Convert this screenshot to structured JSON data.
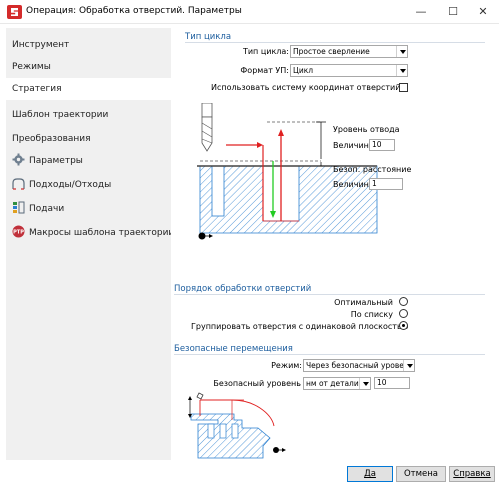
{
  "window": {
    "title": "Операция: Обработка отверстий. Параметры",
    "minimize_glyph": "—",
    "maximize_glyph": "☐",
    "close_glyph": "✕"
  },
  "sidebar": {
    "items": [
      {
        "label": "Инструмент",
        "icon": ""
      },
      {
        "label": "Режимы",
        "icon": ""
      },
      {
        "label": "Стратегия",
        "icon": "",
        "active": true
      },
      {
        "label": "Шаблон траектории",
        "icon": ""
      },
      {
        "label": "Преобразования",
        "icon": ""
      },
      {
        "label": "Параметры",
        "icon": "gear-icon"
      },
      {
        "label": "Подходы/Отходы",
        "icon": "approach-icon"
      },
      {
        "label": "Подачи",
        "icon": "feeds-icon"
      },
      {
        "label": "Макросы шаблона траектории",
        "icon": "macro-icon"
      }
    ]
  },
  "cycle": {
    "section_title": "Тип цикла",
    "type_label": "Тип цикла:",
    "type_value": "Простое сверление",
    "format_label": "Формат УП:",
    "format_value": "Цикл",
    "use_hole_cs_label": "Использовать систему координат отверстий",
    "use_hole_cs_checked": false
  },
  "diagram": {
    "retract_level_label": "Уровень отвода",
    "retract_value_label": "Величина:",
    "retract_value": "10",
    "safe_distance_label": "Безоп. расстояние",
    "safe_value_label": "Величина:",
    "safe_value": "1"
  },
  "order": {
    "section_title": "Порядок обработки отверстий",
    "options": [
      {
        "label": "Оптимальный",
        "selected": false
      },
      {
        "label": "По списку",
        "selected": false
      },
      {
        "label": "Группировать отверстия с одинаковой плоскостью",
        "selected": true
      }
    ]
  },
  "safe_moves": {
    "section_title": "Безопасные перемещения",
    "mode_label": "Режим:",
    "mode_value": "Через безопасный уровень",
    "level_label": "Безопасный уровень",
    "level_mode_value": "нм от детали",
    "level_value": "10"
  },
  "buttons": {
    "ok": "Да",
    "cancel": "Отмена",
    "help": "Справка"
  },
  "colors": {
    "section_title": "#1c5d9e",
    "accent_red": "#e02020",
    "accent_green": "#22cc22",
    "hatch_blue": "#2a7fd0",
    "brand_red": "#d42b2b"
  }
}
